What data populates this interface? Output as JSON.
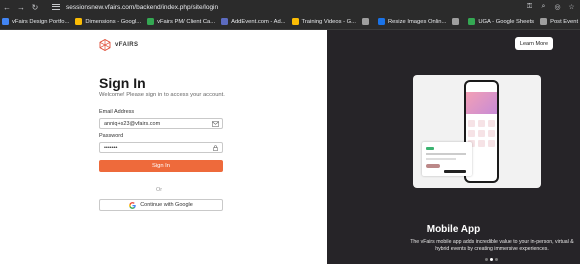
{
  "browser": {
    "url": "sessionsnew.vfairs.com/backend/index.php/site/login",
    "bookmarks": [
      {
        "label": "vFairs Design Portfo...",
        "color": "#4285f4"
      },
      {
        "label": "Dimensions - Googl...",
        "color": "#fbbc04"
      },
      {
        "label": "vFairs PM/ Client Ca...",
        "color": "#34a853"
      },
      {
        "label": "AddEvent.com - Ad...",
        "color": "#5c6bc0"
      },
      {
        "label": "Training Videos - G...",
        "color": "#fbbc04"
      },
      {
        "label": "",
        "color": "#9e9e9e"
      },
      {
        "label": "Resize Images Onlin...",
        "color": "#1a73e8"
      },
      {
        "label": "",
        "color": "#9e9e9e"
      },
      {
        "label": "UGA - Google Sheets",
        "color": "#34a853"
      },
      {
        "label": "Post Event - Client F...",
        "color": "#9e9e9e"
      }
    ]
  },
  "login": {
    "logo_text": "vFAIRS",
    "title": "Sign In",
    "subtitle": "Welcome! Please sign in to access your account.",
    "email_label": "Email Address",
    "email_value": "anniq+s23@vfairs.com",
    "password_label": "Password",
    "password_value": "•••••••",
    "signin_label": "Sign In",
    "or_text": "Or",
    "google_label": "Continue with Google"
  },
  "promo": {
    "learn_more": "Learn More",
    "title": "Mobile App",
    "description": "The vFairs mobile app adds incredible value to your in-person, virtual & hybrid events by creating immersive experiences."
  }
}
